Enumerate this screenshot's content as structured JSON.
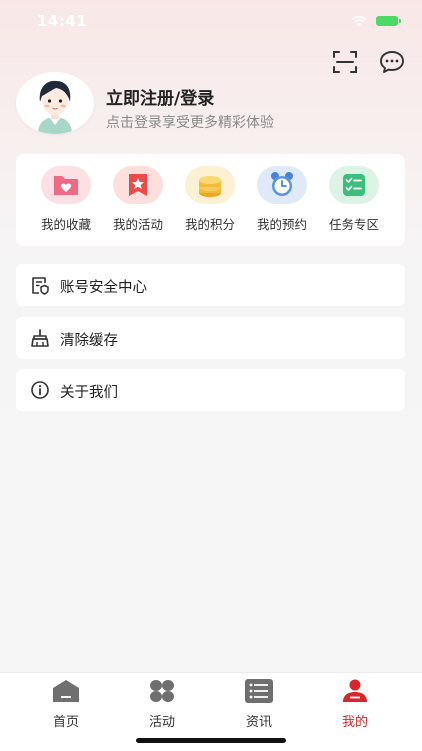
{
  "status_bar": {
    "time": "14:41"
  },
  "profile": {
    "title": "立即注册/登录",
    "subtitle": "点击登录享受更多精彩体验"
  },
  "quick_actions": [
    {
      "label": "我的收藏",
      "icon": "heart-folder-icon"
    },
    {
      "label": "我的活动",
      "icon": "star-badge-icon"
    },
    {
      "label": "我的积分",
      "icon": "coins-icon"
    },
    {
      "label": "我的预约",
      "icon": "alarm-clock-icon"
    },
    {
      "label": "任务专区",
      "icon": "task-list-icon"
    }
  ],
  "menu": [
    {
      "label": "账号安全中心",
      "icon": "shield-document-icon"
    },
    {
      "label": "清除缓存",
      "icon": "broom-icon"
    },
    {
      "label": "关于我们",
      "icon": "info-icon"
    }
  ],
  "tabs": [
    {
      "label": "首页",
      "icon": "home-icon"
    },
    {
      "label": "活动",
      "icon": "grid-icon"
    },
    {
      "label": "资讯",
      "icon": "news-list-icon"
    },
    {
      "label": "我的",
      "icon": "user-icon",
      "active": true
    }
  ],
  "colors": {
    "accent": "#d8262c",
    "tab_inactive": "#6f6f6f",
    "background": "#f6f6f7"
  }
}
